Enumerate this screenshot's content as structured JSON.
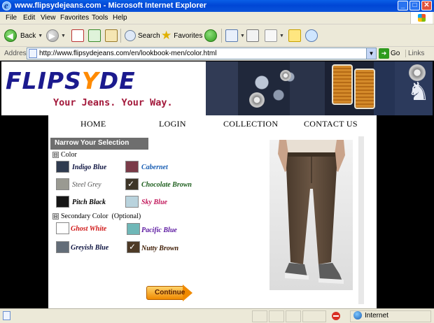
{
  "window": {
    "title": "www.flipsydejeans.com - Microsoft Internet Explorer",
    "min": "_",
    "max": "□",
    "close": "✕"
  },
  "menu": [
    "File",
    "Edit",
    "View",
    "Favorites",
    "Tools",
    "Help"
  ],
  "toolbar": {
    "back": "Back",
    "search": "Search",
    "favorites": "Favorites"
  },
  "address": {
    "label": "Address",
    "url": "http://www.flipsydejeans.com/en/lookbook-men/color.html",
    "go": "Go",
    "links": "Links"
  },
  "site": {
    "logo_pre": "FLIPS",
    "logo_y": "Y",
    "logo_post": "DE",
    "tagline": "Your Jeans. Your Way.",
    "nav": [
      "HOME",
      "LOGIN",
      "COLLECTION",
      "CONTACT US"
    ],
    "panel_title": "Narrow Your Selection",
    "group_color": "Color",
    "group_secondary": "Secondary Color",
    "group_secondary_note": "(Optional)",
    "collapse_glyph": "⊟",
    "colors": [
      {
        "name": "Indigo Blue",
        "swatch": "#2f3b4f",
        "text": "#0d1340",
        "checked": false
      },
      {
        "name": "Cabernet",
        "swatch": "#7a3b48",
        "text": "#1a5fb4",
        "checked": false
      },
      {
        "name": "Steel Grey",
        "swatch": "#9a9a92",
        "text": "#555555",
        "checked": false
      },
      {
        "name": "Chocolate Brown",
        "swatch": "#3d3528",
        "text": "#1d5e1d",
        "checked": true
      },
      {
        "name": "Pitch Black",
        "swatch": "#151515",
        "text": "#000000",
        "checked": false
      },
      {
        "name": "Sky Blue",
        "swatch": "#b9d3dd",
        "text": "#c2185b",
        "checked": false
      }
    ],
    "secondary_colors": [
      {
        "name": "Ghost White",
        "swatch": "#ffffff",
        "text": "#d01818",
        "checked": false
      },
      {
        "name": "Pacific Blue",
        "swatch": "#6fb7b7",
        "text": "#5a16a0",
        "checked": false
      },
      {
        "name": "Greyish Blue",
        "swatch": "#636d78",
        "text": "#0d1340",
        "checked": false
      },
      {
        "name": "Nutty Brown",
        "swatch": "#4d3a26",
        "text": "#3d1a00",
        "checked": true
      }
    ],
    "check_glyph": "✓",
    "continue": "Continue"
  },
  "status": {
    "zone": "Internet"
  }
}
